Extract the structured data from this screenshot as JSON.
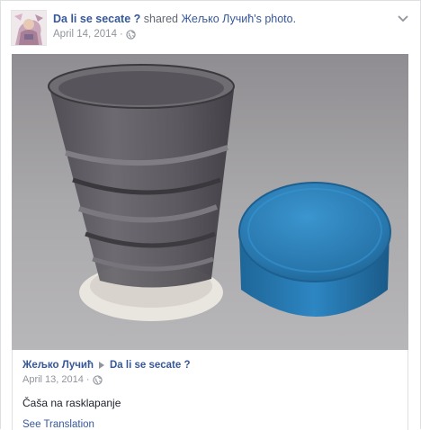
{
  "post": {
    "page_name": "Da li se secate ?",
    "shared_text": " shared ",
    "original_author": "Жељко Лучић",
    "photo_suffix": "'s photo.",
    "date": "April 14, 2014",
    "privacy_icon": "globe-icon",
    "options_icon": "chevron-down-icon"
  },
  "photo": {
    "subject": "collapsible cup",
    "colors": {
      "background": "#a7a6a8",
      "cup": "#5d5b60",
      "lid": "#2c7fb8",
      "ring": "#ece8e2"
    }
  },
  "shared_post": {
    "author": "Жељко Лучић",
    "arrow_icon": "triangle-right-icon",
    "target": "Da li se secate ?",
    "date": "April 13, 2014",
    "caption": "Čaša na rasklapanje",
    "see_translation": "See Translation"
  },
  "colors": {
    "link": "#365899",
    "muted": "#90949c",
    "border": "#dddfe2"
  }
}
